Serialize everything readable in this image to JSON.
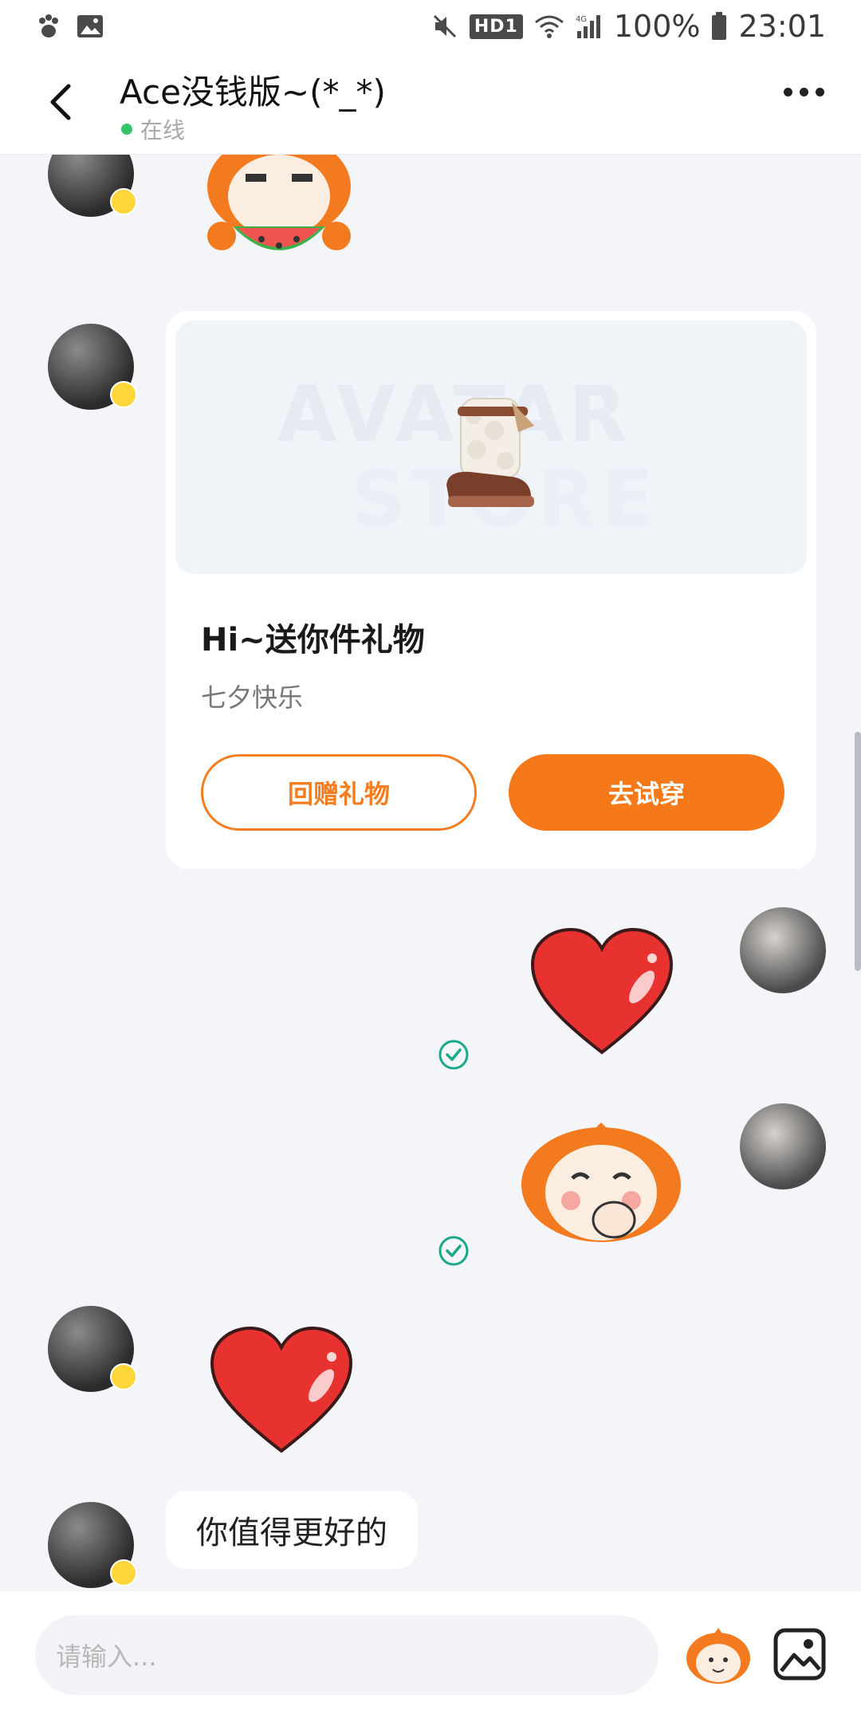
{
  "status_bar": {
    "left_icons": [
      "paw-icon",
      "image-icon"
    ],
    "hd_label": "HD1",
    "network_label": "4G",
    "battery_percent": "100%",
    "time": "23:01"
  },
  "header": {
    "back_icon": "chevron-left-icon",
    "title": "Ace没钱版~(*_*)",
    "status": "在线",
    "status_color": "#36c46b",
    "more_icon": "more-dots-icon"
  },
  "chat": {
    "messages": [
      {
        "side": "left",
        "type": "sticker",
        "sticker": "girl-eating-watermelon-sticker"
      },
      {
        "side": "left",
        "type": "gift_card"
      },
      {
        "side": "right",
        "type": "sticker",
        "sticker": "red-heart-sticker",
        "status": "sent"
      },
      {
        "side": "right",
        "type": "sticker",
        "sticker": "girl-laughing-sticker",
        "status": "sent"
      },
      {
        "side": "left",
        "type": "sticker",
        "sticker": "red-heart-sticker"
      },
      {
        "side": "left",
        "type": "text"
      }
    ],
    "text_message": "你值得更好的"
  },
  "gift_card": {
    "watermark_line1": "AVATAR",
    "watermark_line2": "STORE",
    "item": "fur-boots-icon",
    "title": "Hi~送你件礼物",
    "subtitle": "七夕快乐",
    "return_gift_label": "回赠礼物",
    "try_on_label": "去试穿",
    "accent_color": "#f57819"
  },
  "input_bar": {
    "placeholder": "请输入...",
    "emoji_icon": "sticker-emoji-icon",
    "image_icon": "image-picker-icon"
  }
}
